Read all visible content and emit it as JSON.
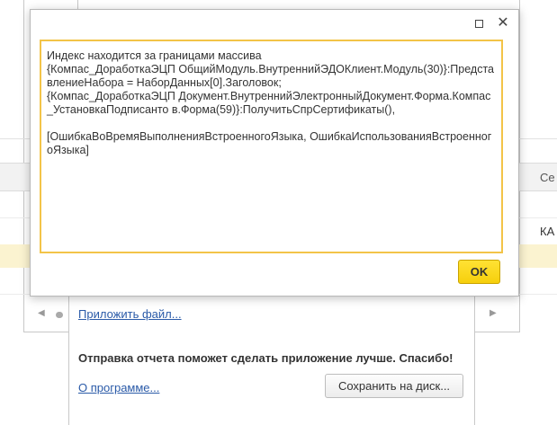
{
  "background_grid": {
    "column_header_fragment": "Се",
    "cell_fragment": "КА"
  },
  "error_dialog": {
    "icons": {
      "maximize": "maximize-icon",
      "close": "close-icon"
    },
    "message": "Индекс находится за границами массива\n{Компас_ДоработкаЭЦП ОбщийМодуль.ВнутреннийЭДОКлиент.Модуль(30)}:ПредставлениеНабора = НаборДанных[0].Заголовок;\n{Компас_ДоработкаЭЦП Документ.ВнутреннийЭлектронныйДокумент.Форма.Компас_УстановкаПодписанто в.Форма(59)}:ПолучитьСпрСертификаты(),\n\n[ОшибкаВоВремяВыполненияВстроенногоЯзыка, ОшибкаИспользованияВстроенногоЯзыка]",
    "ok_label": "OK",
    "colors": {
      "ok_button": "#f6cf0c",
      "message_border": "#f3c448"
    }
  },
  "report_dialog": {
    "attach_link": "Приложить файл...",
    "thanks_text": "Отправка отчета поможет сделать приложение лучше. Спасибо!",
    "about_link": "О программе...",
    "save_button_label": "Сохранить на диск..."
  }
}
